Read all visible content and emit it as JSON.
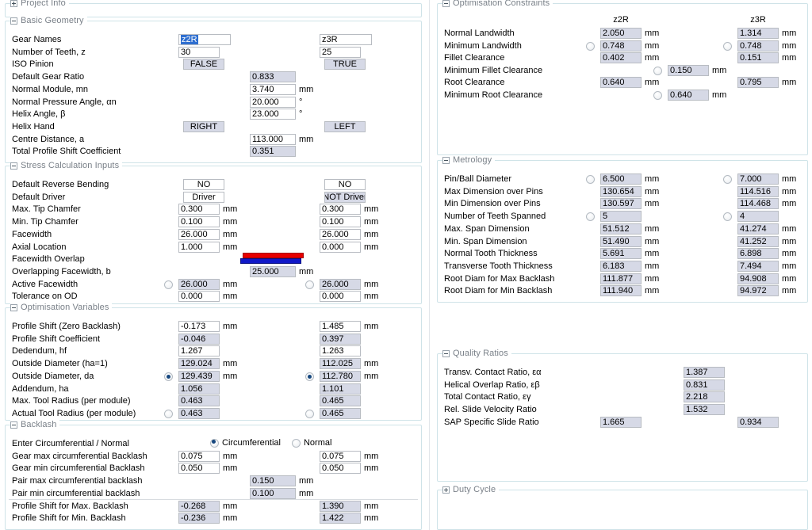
{
  "app": {
    "gear_a": "z2R",
    "gear_b": "z3R",
    "unit_mm": "mm",
    "unit_deg": "°"
  },
  "groups": {
    "project_info": {
      "title": "Project Info",
      "expanded": false
    },
    "basic_geometry": {
      "title": "Basic Geometry",
      "expanded": true
    },
    "stress_inputs": {
      "title": "Stress Calculation Inputs",
      "expanded": true
    },
    "optimisation_variables": {
      "title": "Optimisation Variables",
      "expanded": true
    },
    "backlash": {
      "title": "Backlash",
      "expanded": true
    },
    "optimisation_constraints": {
      "title": "Optimisation Constraints",
      "expanded": true
    },
    "metrology": {
      "title": "Metrology",
      "expanded": true
    },
    "quality_ratios": {
      "title": "Quality Ratios",
      "expanded": true
    },
    "duty_cycle": {
      "title": "Duty Cycle",
      "expanded": false
    }
  },
  "basic_geometry": {
    "rows": [
      {
        "label": "Gear Names",
        "a": "z2R",
        "b": "z3R"
      },
      {
        "label": "Number of Teeth, z",
        "a": "30",
        "b": "25"
      },
      {
        "label": "ISO Pinion",
        "a": "FALSE",
        "b": "TRUE"
      },
      {
        "label": "Default Gear Ratio",
        "mid": "0.833"
      },
      {
        "label": "Normal Module, mn",
        "mid": "3.740",
        "unit": "mm"
      },
      {
        "label": "Normal Pressure Angle, αn",
        "mid": "20.000",
        "unit": "°"
      },
      {
        "label": "Helix Angle, β",
        "mid": "23.000",
        "unit": "°"
      },
      {
        "label": "Helix Hand",
        "a": "RIGHT",
        "b": "LEFT"
      },
      {
        "label": "Centre Distance, a",
        "mid": "113.000",
        "unit": "mm"
      },
      {
        "label": "Total Profile Shift Coefficient",
        "mid": "0.351"
      }
    ]
  },
  "stress_inputs": {
    "rows": [
      {
        "label": "Default Reverse Bending",
        "a": "NO",
        "b": "NO"
      },
      {
        "label": "Default Driver",
        "a": "Driver",
        "b": "NOT Driver"
      },
      {
        "label": "Max. Tip Chamfer",
        "a": "0.300",
        "b": "0.300",
        "unit": "mm"
      },
      {
        "label": "Min. Tip Chamfer",
        "a": "0.100",
        "b": "0.100",
        "unit": "mm"
      },
      {
        "label": "Facewidth",
        "a": "26.000",
        "b": "26.000",
        "unit": "mm"
      },
      {
        "label": "Axial Location",
        "a": "1.000",
        "b": "0.000",
        "unit": "mm"
      },
      {
        "label": "Facewidth Overlap"
      },
      {
        "label": "Overlapping Facewidth, b",
        "mid": "25.000",
        "unit": "mm"
      },
      {
        "label": "Active Facewidth",
        "a": "26.000",
        "b": "26.000",
        "unit": "mm"
      },
      {
        "label": "Tolerance on OD",
        "a": "0.000",
        "b": "0.000",
        "unit": "mm"
      }
    ]
  },
  "optimisation_variables": {
    "rows": [
      {
        "label": "Profile Shift (Zero Backlash)",
        "a": "-0.173",
        "b": "1.485",
        "unit": "mm"
      },
      {
        "label": "Profile Shift Coefficient",
        "a": "-0.046",
        "b": "0.397"
      },
      {
        "label": "Dedendum, hf",
        "a": "1.267",
        "b": "1.263"
      },
      {
        "label": "Outside Diameter (ha=1)",
        "a": "129.024",
        "b": "112.025",
        "unit": "mm"
      },
      {
        "label": "Outside Diameter, da",
        "a": "129.439",
        "b": "112.780",
        "unit": "mm"
      },
      {
        "label": "Addendum, ha",
        "a": "1.056",
        "b": "1.101"
      },
      {
        "label": "Max. Tool Radius (per module)",
        "a": "0.463",
        "b": "0.465"
      },
      {
        "label": "Actual Tool Radius (per module)",
        "a": "0.463",
        "b": "0.465"
      }
    ]
  },
  "backlash": {
    "mode_label": "Enter Circumferential / Normal",
    "mode_options": [
      {
        "label": "Circumferential",
        "selected": true
      },
      {
        "label": "Normal",
        "selected": false
      }
    ],
    "rows": [
      {
        "label": "Gear max circumferential Backlash",
        "a": "0.075",
        "b": "0.075",
        "unit": "mm"
      },
      {
        "label": "Gear min circumferential Backlash",
        "a": "0.050",
        "b": "0.050",
        "unit": "mm"
      },
      {
        "label": "Pair max circumferential backlash",
        "mid": "0.150",
        "unit": "mm"
      },
      {
        "label": "Pair min circumferential backlash",
        "mid": "0.100",
        "unit": "mm"
      },
      {
        "label": "Profile Shift for Max. Backlash",
        "a": "-0.268",
        "b": "1.390",
        "unit": "mm"
      },
      {
        "label": "Profile Shift for Min. Backlash",
        "a": "-0.236",
        "b": "1.422",
        "unit": "mm"
      }
    ]
  },
  "optimisation_constraints": {
    "col_a": "z2R",
    "col_b": "z3R",
    "rows": [
      {
        "label": "Normal Landwidth",
        "a": "2.050",
        "b": "1.314",
        "unit": "mm"
      },
      {
        "label": "Minimum Landwidth",
        "a": "0.748",
        "b": "0.748",
        "unit": "mm"
      },
      {
        "label": "Fillet Clearance",
        "a": "0.402",
        "b": "0.151",
        "unit": "mm"
      },
      {
        "label": "Minimum Fillet Clearance",
        "mid": "0.150",
        "unit": "mm"
      },
      {
        "label": "Root Clearance",
        "a": "0.640",
        "b": "0.795",
        "unit": "mm"
      },
      {
        "label": "Minimum Root Clearance",
        "mid": "0.640",
        "unit": "mm"
      }
    ]
  },
  "metrology": {
    "rows": [
      {
        "label": "Pin/Ball Diameter",
        "a": "6.500",
        "b": "7.000",
        "unit": "mm"
      },
      {
        "label": "Max Dimension over Pins",
        "a": "130.654",
        "b": "114.516",
        "unit": "mm"
      },
      {
        "label": "Min Dimension over Pins",
        "a": "130.597",
        "b": "114.468",
        "unit": "mm"
      },
      {
        "label": "Number of Teeth Spanned",
        "a": "5",
        "b": "4"
      },
      {
        "label": "Max. Span Dimension",
        "a": "51.512",
        "b": "41.274",
        "unit": "mm"
      },
      {
        "label": "Min. Span Dimension",
        "a": "51.490",
        "b": "41.252",
        "unit": "mm"
      },
      {
        "label": "Normal Tooth Thickness",
        "a": "5.691",
        "b": "6.898",
        "unit": "mm"
      },
      {
        "label": "Transverse Tooth Thickness",
        "a": "6.183",
        "b": "7.494",
        "unit": "mm"
      },
      {
        "label": "Root Diam for Max Backlash",
        "a": "111.877",
        "b": "94.908",
        "unit": "mm"
      },
      {
        "label": "Root Diam for Min Backlash",
        "a": "111.940",
        "b": "94.972",
        "unit": "mm"
      }
    ]
  },
  "quality_ratios": {
    "rows": [
      {
        "label": "Transv. Contact Ratio, εα",
        "mid": "1.387"
      },
      {
        "label": "Helical Overlap Ratio, εβ",
        "mid": "0.831"
      },
      {
        "label": "Total Contact Ratio, εγ",
        "mid": "2.218"
      },
      {
        "label": "Rel. Slide Velocity Ratio",
        "mid": "1.532"
      },
      {
        "label": "SAP Specific Slide Ratio",
        "a": "1.665",
        "b": "0.934"
      }
    ]
  },
  "colors": {
    "overlap_bar_red": "#e60000",
    "overlap_bar_blue": "#1018c8",
    "readonly_field": "#d6d9e6",
    "group_border": "#cfe3e8",
    "selection": "#2f6fd0"
  }
}
